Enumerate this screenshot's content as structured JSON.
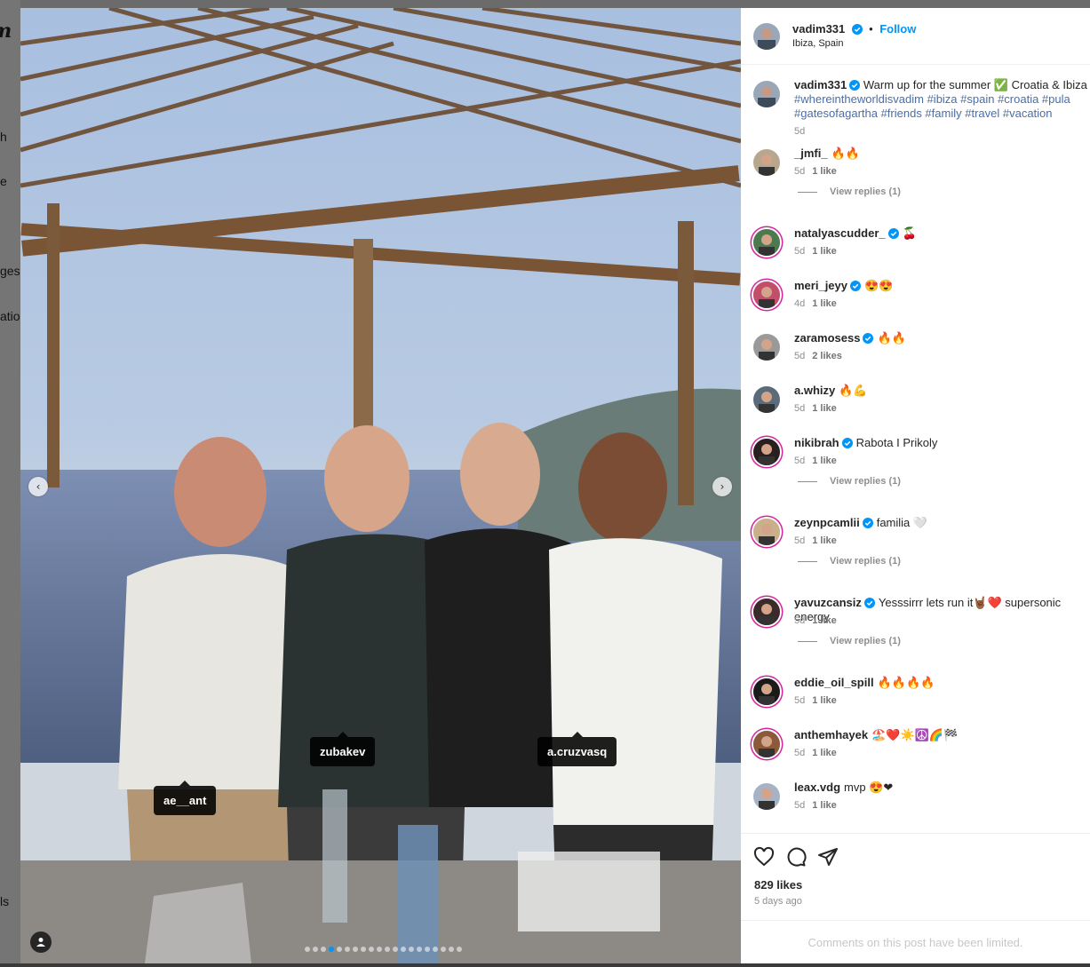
{
  "background": {
    "sidebar_fragments": [
      "m",
      "h",
      "e",
      "ges",
      "ation",
      "ls"
    ]
  },
  "photo": {
    "prev_label": "‹",
    "next_label": "›",
    "tags": [
      "zubakev",
      "a.cruzvasq",
      "ae__ant"
    ],
    "carousel_count": 20,
    "carousel_active": 3
  },
  "post": {
    "author": "vadim331",
    "separator": "•",
    "follow_label": "Follow",
    "location": "Ibiza, Spain",
    "caption_text": "Warm up for the summer ✅ Croatia & Ibiza",
    "caption_hashtags": "#whereintheworldisvadim #ibiza #spain #croatia #pula #gatesofagartha #friends #family #travel #vacation",
    "caption_time": "5d"
  },
  "comments": [
    {
      "user": "_jmfi_",
      "verified": false,
      "text": "🔥🔥",
      "time": "5d",
      "likes": "1 like",
      "replies": "View replies (1)"
    },
    {
      "user": "natalyascudder_",
      "verified": true,
      "text": "🍒",
      "time": "5d",
      "likes": "1 like",
      "replies": ""
    },
    {
      "user": "meri_jeyy",
      "verified": true,
      "text": "😍😍",
      "time": "4d",
      "likes": "1 like",
      "replies": ""
    },
    {
      "user": "zaramosess",
      "verified": true,
      "text": "🔥🔥",
      "time": "5d",
      "likes": "2 likes",
      "replies": ""
    },
    {
      "user": "a.whizy",
      "verified": false,
      "text": "🔥💪",
      "time": "5d",
      "likes": "1 like",
      "replies": ""
    },
    {
      "user": "nikibrah",
      "verified": true,
      "text": "Rabota I Prikoly",
      "time": "5d",
      "likes": "1 like",
      "replies": "View replies (1)"
    },
    {
      "user": "zeynpcamlii",
      "verified": true,
      "text": "familia 🤍",
      "time": "5d",
      "likes": "1 like",
      "replies": "View replies (1)"
    },
    {
      "user": "yavuzcansiz",
      "verified": true,
      "text": "Yesssirrr lets run it🤘🏾❤️ supersonic energy",
      "time": "5d",
      "likes": "1 like",
      "replies": "View replies (1)"
    },
    {
      "user": "eddie_oil_spill",
      "verified": false,
      "text": "🔥🔥🔥🔥",
      "time": "5d",
      "likes": "1 like",
      "replies": ""
    },
    {
      "user": "anthemhayek",
      "verified": false,
      "text": "🏖️❤️☀️☮️🌈🏁",
      "time": "5d",
      "likes": "1 like",
      "replies": ""
    },
    {
      "user": "leax.vdg",
      "verified": false,
      "text": "mvp 😍❤",
      "time": "5d",
      "likes": "1 like",
      "replies": ""
    }
  ],
  "actions": {
    "likes": "829 likes",
    "posted": "5 days ago"
  },
  "footer": {
    "limited_text": "Comments on this post have been limited."
  },
  "colors": {
    "accent": "#0095f6",
    "verified": "#0095f6",
    "ring": "#d6249f"
  }
}
